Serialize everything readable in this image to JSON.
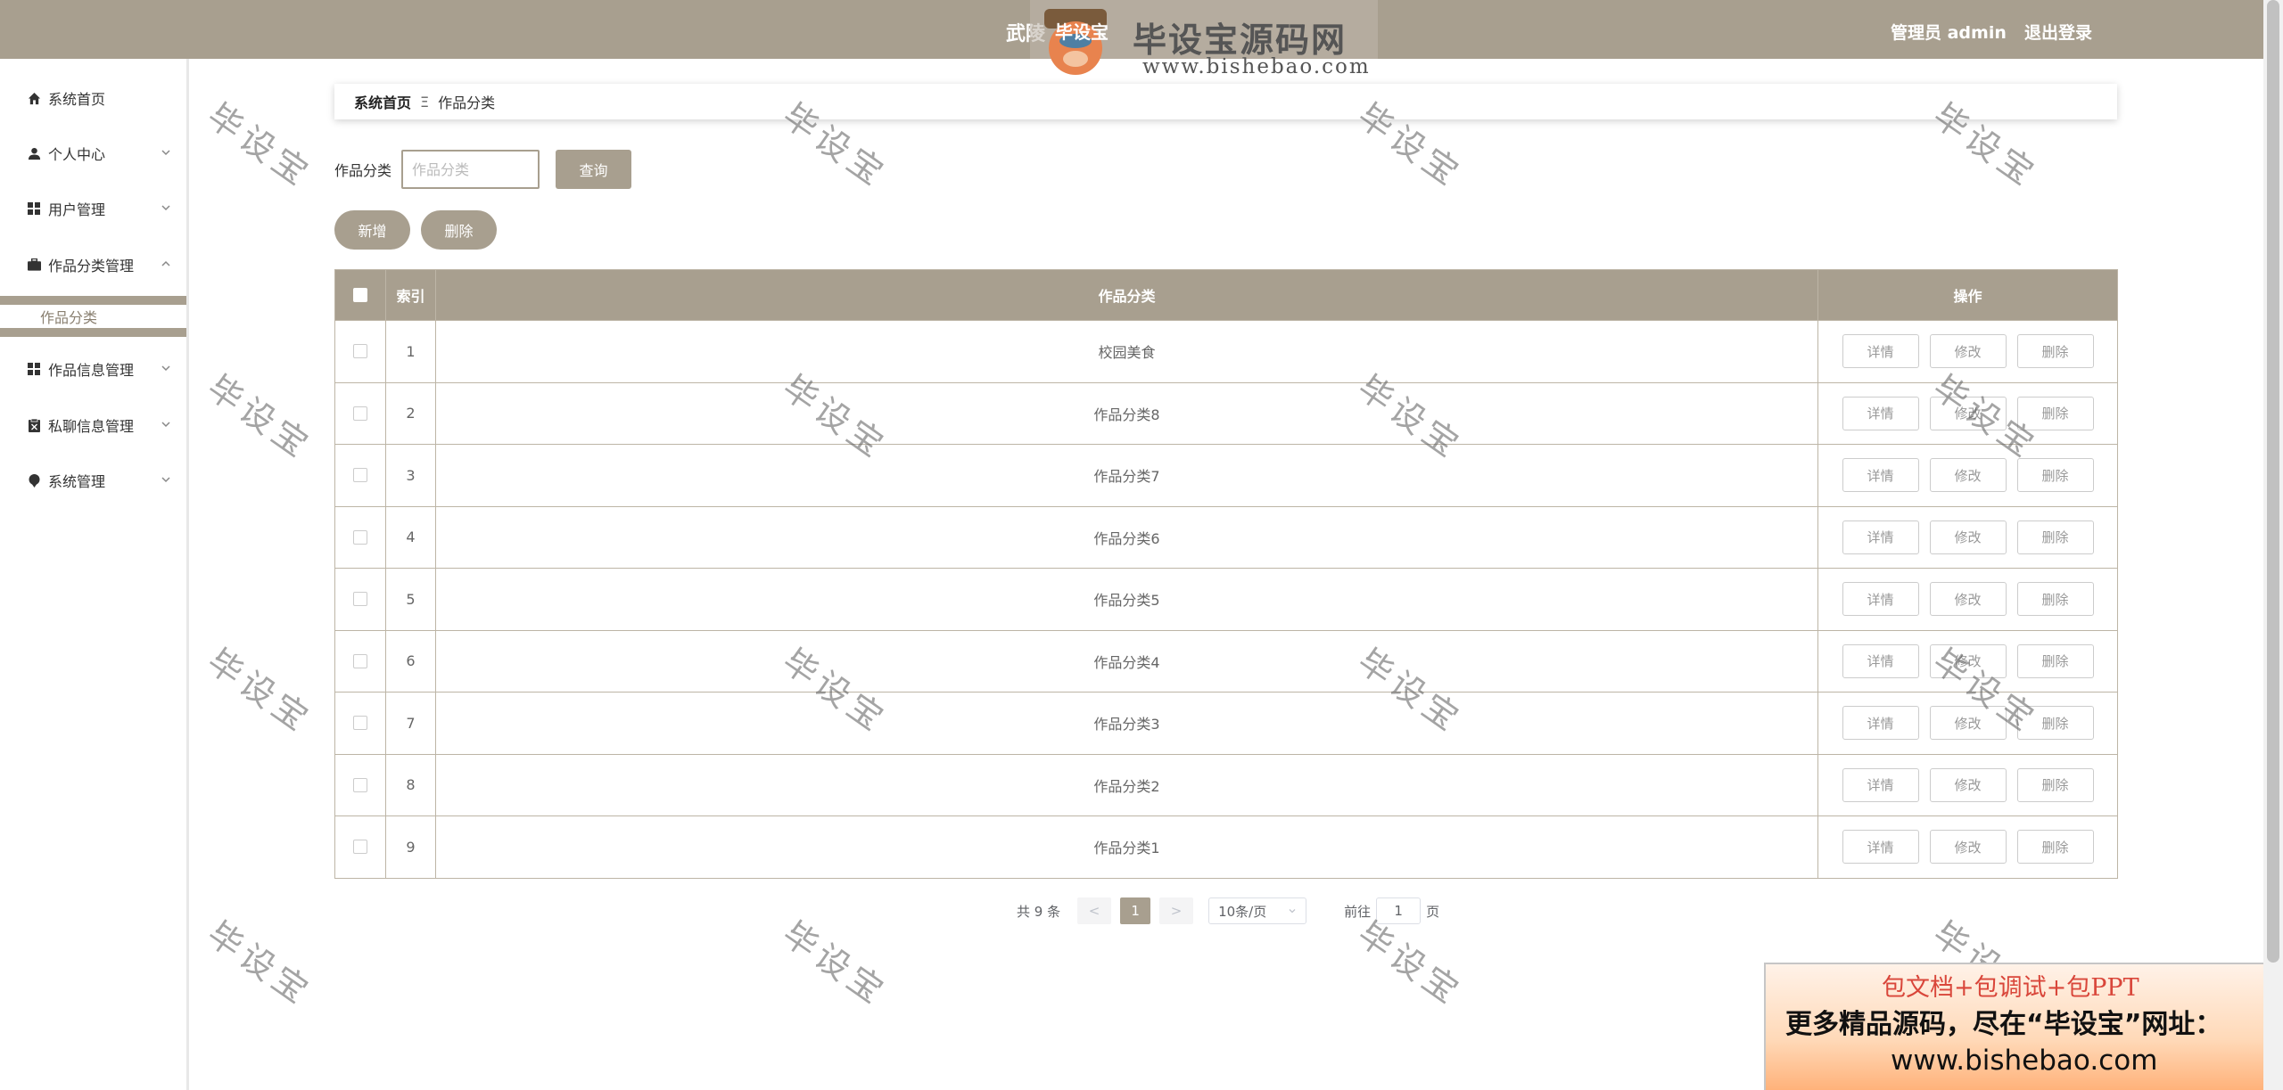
{
  "header": {
    "title": "武陵",
    "admin_label": "管理员 admin",
    "logout_label": "退出登录"
  },
  "sidebar": {
    "items": [
      {
        "label": "系统首页",
        "icon": "home-icon"
      },
      {
        "label": "个人中心",
        "icon": "user-icon"
      },
      {
        "label": "用户管理",
        "icon": "grid-icon"
      },
      {
        "label": "作品分类管理",
        "icon": "briefcase-icon"
      },
      {
        "label": "作品信息管理",
        "icon": "grid-icon"
      },
      {
        "label": "私聊信息管理",
        "icon": "clipboard-icon"
      },
      {
        "label": "系统管理",
        "icon": "pin-icon"
      }
    ],
    "subitem": "作品分类"
  },
  "breadcrumb": {
    "home": "系统首页",
    "separator": "Ξ",
    "current": "作品分类"
  },
  "search": {
    "label": "作品分类",
    "placeholder": "作品分类",
    "query_button": "查询"
  },
  "actions": {
    "add": "新增",
    "delete": "删除"
  },
  "table": {
    "columns": [
      "索引",
      "作品分类",
      "操作"
    ],
    "rows": [
      {
        "index": "1",
        "name": "校园美食"
      },
      {
        "index": "2",
        "name": "作品分类8"
      },
      {
        "index": "3",
        "name": "作品分类7"
      },
      {
        "index": "4",
        "name": "作品分类6"
      },
      {
        "index": "5",
        "name": "作品分类5"
      },
      {
        "index": "6",
        "name": "作品分类4"
      },
      {
        "index": "7",
        "name": "作品分类3"
      },
      {
        "index": "8",
        "name": "作品分类2"
      },
      {
        "index": "9",
        "name": "作品分类1"
      }
    ],
    "row_actions": {
      "detail": "详情",
      "edit": "修改",
      "delete": "删除"
    }
  },
  "pagination": {
    "total": "共 9 条",
    "prev": "<",
    "current_page": "1",
    "next": ">",
    "page_size": "10条/页",
    "goto_prefix": "前往",
    "goto_value": "1",
    "goto_suffix": "页"
  },
  "watermark": {
    "text": "毕设宝",
    "logo_title": "毕设宝源码网",
    "logo_url": "www.bishebao.com",
    "logo_overlay": "毕设宝"
  },
  "promo": {
    "line1": "包文档+包调试+包PPT",
    "line2": "更多精品源码，尽在“毕设宝”网址：",
    "line3": "www.bishebao.com"
  },
  "colors": {
    "primary": "#a89f8f",
    "promo_red": "#d9463a"
  }
}
